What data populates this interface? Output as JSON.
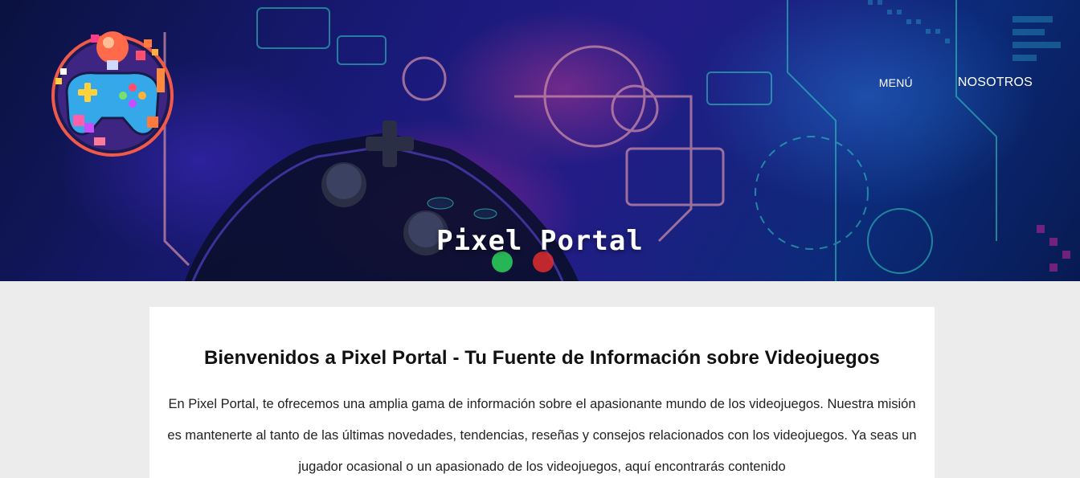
{
  "header": {
    "logo_name": "pixel-portal-gamepad-logo",
    "nav": {
      "menu_label": "MENÚ",
      "about_label": "NOSOTROS"
    },
    "hero_title": "Pixel Portal"
  },
  "main": {
    "heading": "Bienvenidos a Pixel Portal - Tu Fuente de Información sobre Videojuegos",
    "intro": "En Pixel Portal, te ofrecemos una amplia gama de información sobre el apasionante mundo de los videojuegos. Nuestra misión es mantenerte al tanto de las últimas novedades, tendencias, reseñas y consejos relacionados con los videojuegos. Ya seas un jugador ocasional o un apasionado de los videojuegos, aquí encontrarás contenido"
  },
  "colors": {
    "page_background": "#ececec",
    "hero_base": "#1a1a7a",
    "accent_pink": "#d6289f",
    "accent_teal": "#2fd3c3",
    "card_background": "#ffffff"
  }
}
